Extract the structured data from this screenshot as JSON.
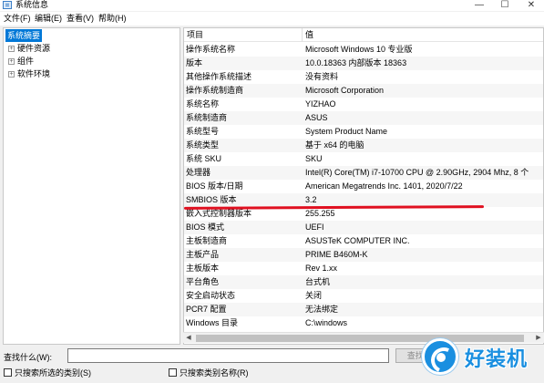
{
  "window": {
    "title": "系统信息",
    "controls": {
      "minimize": "—",
      "maximize": "☐",
      "close": "✕"
    }
  },
  "menu": [
    "文件(F)",
    "编辑(E)",
    "查看(V)",
    "帮助(H)"
  ],
  "tree": {
    "items": [
      {
        "label": "系统摘要",
        "selected": true,
        "expander": ""
      },
      {
        "label": "硬件资源",
        "selected": false,
        "expander": "+"
      },
      {
        "label": "组件",
        "selected": false,
        "expander": "+"
      },
      {
        "label": "软件环境",
        "selected": false,
        "expander": "+"
      }
    ]
  },
  "list": {
    "headers": {
      "item": "项目",
      "value": "值"
    },
    "rows": [
      {
        "k": "操作系统名称",
        "v": "Microsoft Windows 10 专业版"
      },
      {
        "k": "版本",
        "v": "10.0.18363 内部版本 18363"
      },
      {
        "k": "其他操作系统描述",
        "v": "没有资料"
      },
      {
        "k": "操作系统制造商",
        "v": "Microsoft Corporation"
      },
      {
        "k": "系统名称",
        "v": "YIZHAO"
      },
      {
        "k": "系统制造商",
        "v": "ASUS"
      },
      {
        "k": "系统型号",
        "v": "System Product Name"
      },
      {
        "k": "系统类型",
        "v": "基于 x64 的电脑"
      },
      {
        "k": "系统 SKU",
        "v": "SKU"
      },
      {
        "k": "处理器",
        "v": "Intel(R) Core(TM) i7-10700 CPU @ 2.90GHz, 2904 Mhz, 8 个"
      },
      {
        "k": "BIOS 版本/日期",
        "v": "American Megatrends Inc. 1401, 2020/7/22"
      },
      {
        "k": "SMBIOS 版本",
        "v": "3.2"
      },
      {
        "k": "嵌入式控制器版本",
        "v": "255.255"
      },
      {
        "k": "BIOS 模式",
        "v": "UEFI"
      },
      {
        "k": "主板制造商",
        "v": "ASUSTeK COMPUTER INC."
      },
      {
        "k": "主板产品",
        "v": "PRIME B460M-K"
      },
      {
        "k": "主板版本",
        "v": "Rev 1.xx"
      },
      {
        "k": "平台角色",
        "v": "台式机"
      },
      {
        "k": "安全启动状态",
        "v": "关闭"
      },
      {
        "k": "PCR7 配置",
        "v": "无法绑定"
      },
      {
        "k": "Windows 目录",
        "v": "C:\\windows"
      }
    ]
  },
  "scrollbar": {
    "left_arrow": "◀",
    "right_arrow": "▶"
  },
  "find": {
    "label": "查找什么(W):",
    "value": "",
    "button": "查找(D)",
    "option1": "只搜索所选的类别(S)",
    "option2": "只搜索类别名称(R)"
  },
  "watermark": {
    "text": "好装机"
  },
  "colors": {
    "selection": "#0078d7",
    "annotation": "#e01020",
    "watermark": "#1a8fe0"
  }
}
